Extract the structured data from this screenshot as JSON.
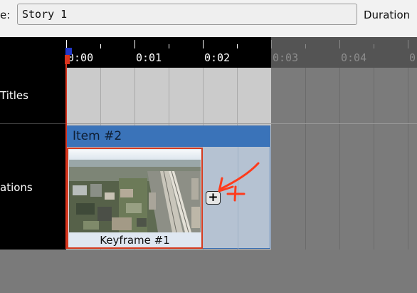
{
  "header": {
    "name_label": "e:",
    "name_value": "Story 1",
    "duration_label": "Duration"
  },
  "ruler": {
    "ticks": [
      "0:00",
      "0:01",
      "0:02",
      "0:03",
      "0:04",
      "0"
    ]
  },
  "tracks": {
    "titles_label": "Titles",
    "animations_label": "ations"
  },
  "item": {
    "title": "Item #2",
    "keyframe_label": "Keyframe #1",
    "add_keyframe_symbol": "+"
  },
  "colors": {
    "item_header": "#3a73b9",
    "keyframe_border": "#d43a1e",
    "annotation_arrow": "#ff3b1c"
  }
}
